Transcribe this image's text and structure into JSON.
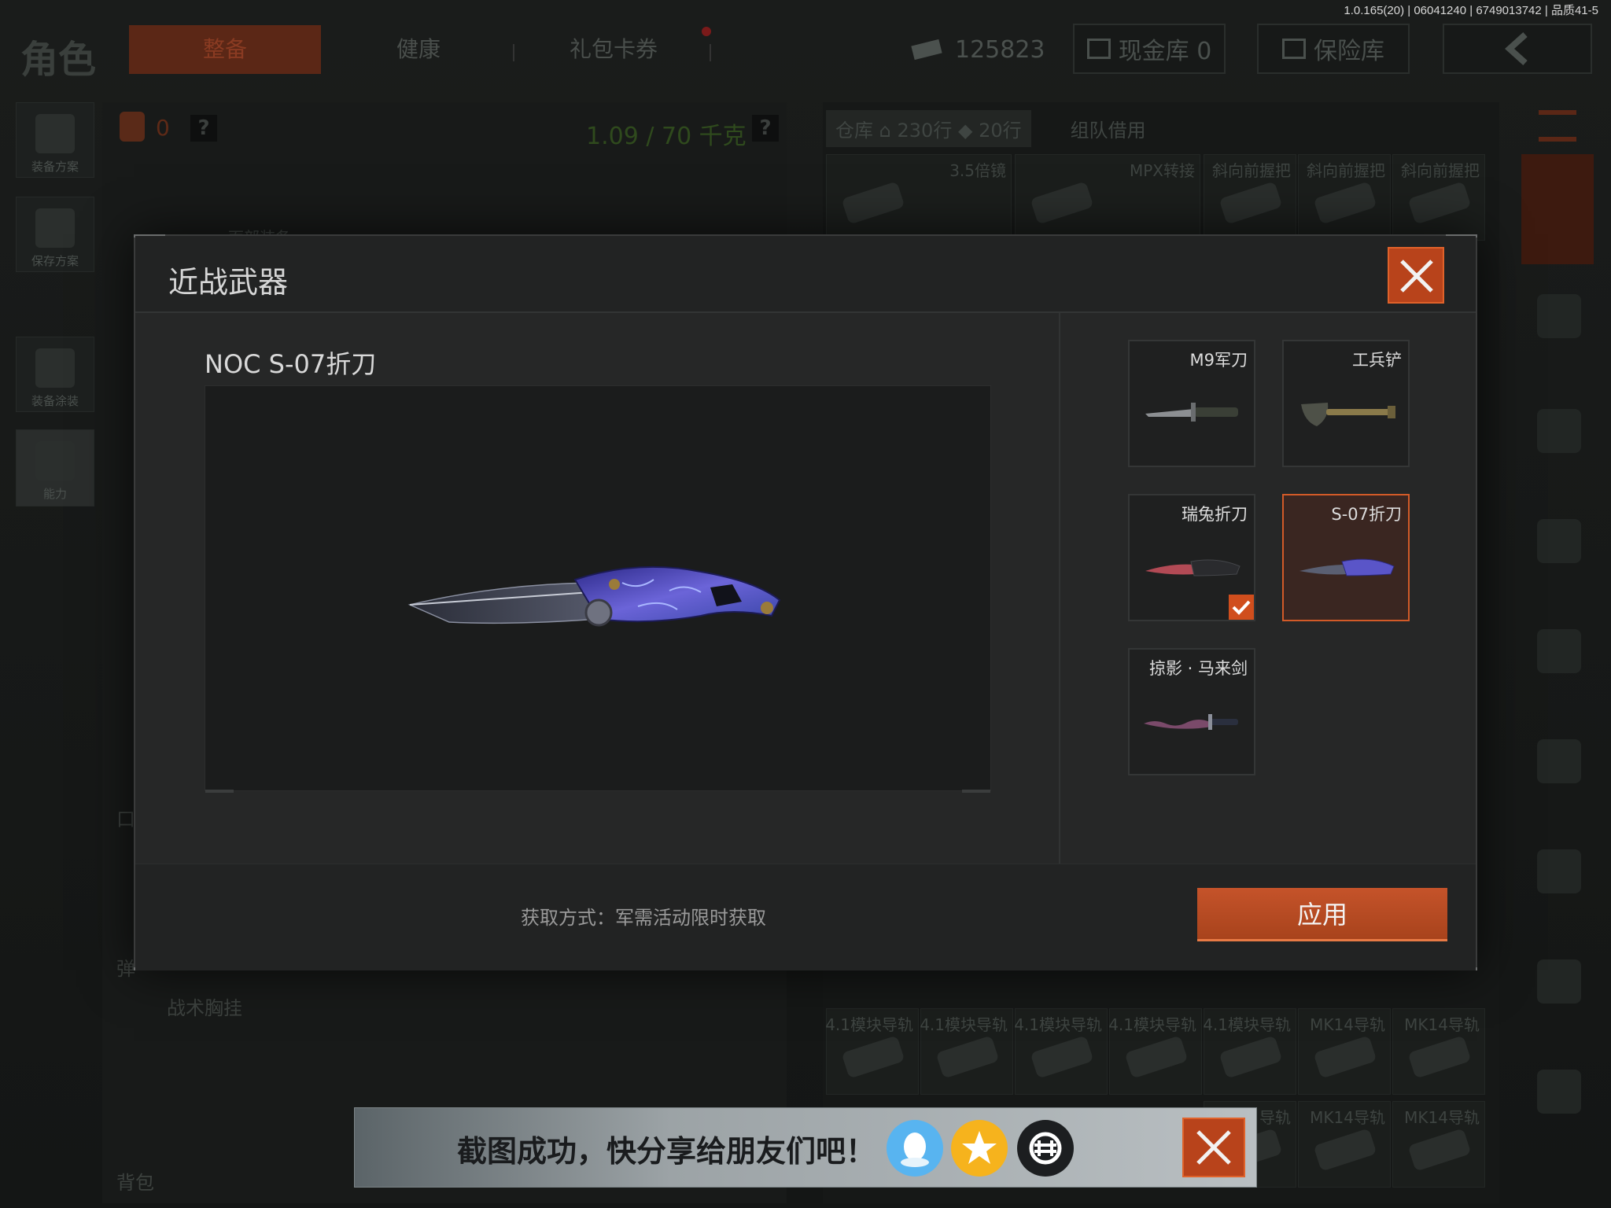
{
  "version": "1.0.165(20) | 06041240 | 6749013742 | 品质41-5",
  "top_nav": {
    "role_title": "角色",
    "tabs": [
      "整备",
      "健康",
      "礼包卡券"
    ],
    "active_tab": "整备",
    "currency_amount": "125823",
    "cash_vault": "现金库 0",
    "safe_box": "保险库"
  },
  "left_sidebar": [
    {
      "label": "装备方案",
      "icon": "vest-icon"
    },
    {
      "label": "保存方案",
      "icon": "download-icon"
    },
    {
      "label": "装备涂装",
      "icon": "helmet-icon"
    },
    {
      "label": "能力",
      "icon": "lightning-icon"
    }
  ],
  "loadout": {
    "bag_count": "0",
    "weight": "1.09 / 70 千克",
    "help_mark": "?",
    "chest_rig_label": "战术胸挂",
    "backpack_label": "背包",
    "partial_labels": [
      "面部装备",
      "口",
      "弹"
    ]
  },
  "inventory": {
    "warehouse_label": "仓库",
    "rows_home": "230行",
    "rows_tag": "20行",
    "team_borrow": "组队借用",
    "top_items": [
      "3.5倍镜",
      "MPX转接",
      "斜向前握把",
      "斜向前握把",
      "斜向前握把"
    ],
    "bottom_row_1": [
      "4.1模块导轨",
      "4.1模块导轨",
      "4.1模块导轨",
      "4.1模块导轨",
      "4.1模块导轨",
      "MK14导轨",
      "MK14导轨"
    ],
    "bottom_row_2": [
      "导轨",
      "MK14导轨",
      "MK14导轨"
    ]
  },
  "modal": {
    "title": "近战武器",
    "selected_weapon_name": "NOC S-07折刀",
    "acquire_method": "获取方式：军需活动限时获取",
    "apply_label": "应用",
    "items": [
      {
        "name": "M9军刀",
        "art": "bayonet-icon",
        "selected": false,
        "equipped": false
      },
      {
        "name": "工兵铲",
        "art": "shovel-icon",
        "selected": false,
        "equipped": false
      },
      {
        "name": "瑞兔折刀",
        "art": "folding-knife-icon",
        "selected": false,
        "equipped": true
      },
      {
        "name": "S-07折刀",
        "art": "folding-knife-icon",
        "selected": true,
        "equipped": false
      },
      {
        "name": "掠影 · 马来剑",
        "art": "kris-sword-icon",
        "selected": false,
        "equipped": false
      }
    ]
  },
  "share_toast": {
    "message": "截图成功，快分享给朋友们吧！",
    "buttons": [
      "qq-icon",
      "qzone-star-icon",
      "wechat-moments-icon"
    ]
  },
  "colors": {
    "accent": "#c5532a",
    "selected_border": "#d25a28",
    "weight_green": "#2f4a1d"
  }
}
